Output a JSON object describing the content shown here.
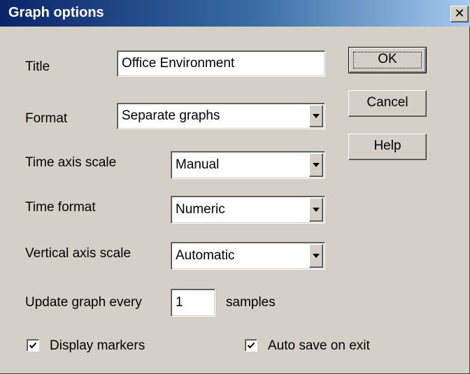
{
  "window": {
    "title": "Graph options",
    "close_glyph": "✕"
  },
  "fields": {
    "title": {
      "label": "Title",
      "value": "Office Environment"
    },
    "format": {
      "label": "Format",
      "value": "Separate graphs"
    },
    "time_axis_scale": {
      "label": "Time axis scale",
      "value": "Manual"
    },
    "time_format": {
      "label": "Time format",
      "value": "Numeric"
    },
    "vertical_axis_scale": {
      "label": "Vertical axis scale",
      "value": "Automatic"
    },
    "update_graph": {
      "label": "Update graph every",
      "value": "1",
      "suffix": "samples"
    }
  },
  "checkboxes": {
    "display_markers": {
      "label": "Display markers",
      "checked": true
    },
    "auto_save": {
      "label": "Auto save on exit",
      "checked": true
    }
  },
  "buttons": {
    "ok": "OK",
    "cancel": "Cancel",
    "help": "Help"
  },
  "icons": {
    "close": "close-icon",
    "dropdown": "chevron-down-icon",
    "check": "check-icon"
  }
}
